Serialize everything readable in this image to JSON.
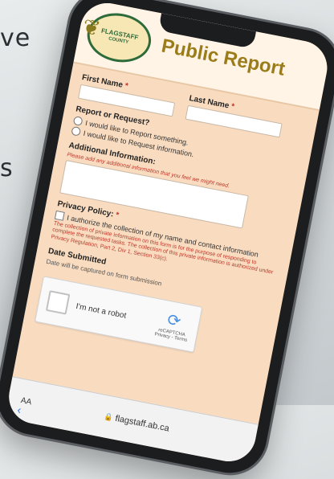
{
  "background": {
    "text_line_1": "ve",
    "text_line_2": "s"
  },
  "header": {
    "logo_name": "FLAGSTAFF",
    "logo_county": "COUNTY",
    "title": "Public Report"
  },
  "form": {
    "first_name_label": "First Name",
    "last_name_label": "Last Name",
    "required_mark": "*",
    "report_request_label": "Report or Request?",
    "radio_options": [
      "I would like to Report something.",
      "I would like to Request information."
    ],
    "additional_info_label": "Additional Information:",
    "additional_info_hint": "Please add any additional information that you feel we might need.",
    "privacy_label": "Privacy Policy:",
    "privacy_checkbox_text": "I authorize the collection of my name and contact information",
    "privacy_small_text": "The collection of private information on this form is for the purpose of responding to complete the requested tasks. The collection of this private information is authorized under Privacy Regulation, Part 2, Div 1, Section 33(c).",
    "date_label": "Date Submitted",
    "date_note": "Date will be captured on form submission"
  },
  "captcha": {
    "label": "I'm not a robot",
    "brand": "reCAPTCHA",
    "links": "Privacy - Terms"
  },
  "browser": {
    "aa_label": "AA",
    "url": "flagstaff.ab.ca",
    "back_icon": "chevron-left-icon"
  }
}
